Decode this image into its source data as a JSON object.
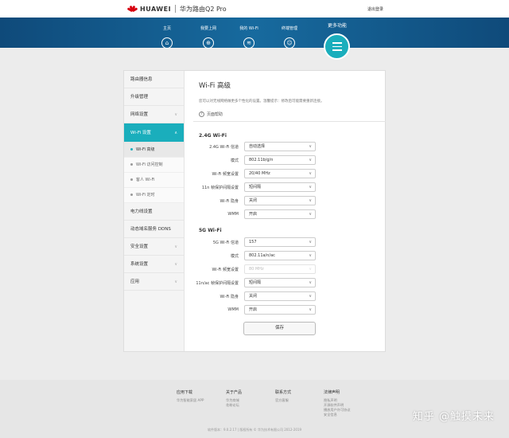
{
  "header": {
    "brand": "HUAWEI",
    "product": "华为路由Q2 Pro",
    "logout": "退出登录"
  },
  "nav": {
    "items": [
      {
        "label": "主页",
        "icon": "home-icon"
      },
      {
        "label": "我要上网",
        "icon": "globe-icon"
      },
      {
        "label": "我的 Wi-Fi",
        "icon": "wifi-icon"
      },
      {
        "label": "终端管理",
        "icon": "user-icon"
      }
    ],
    "more": "更多功能"
  },
  "sidebar": {
    "items": [
      {
        "label": "路由器信息"
      },
      {
        "label": "升级管理"
      },
      {
        "label": "网络设置"
      },
      {
        "label": "Wi-Fi 设置"
      },
      {
        "label": "电力线设置"
      },
      {
        "label": "动态域名服务 DDNS"
      },
      {
        "label": "安全设置"
      },
      {
        "label": "系统设置"
      },
      {
        "label": "应用"
      }
    ],
    "sub": [
      {
        "label": "Wi-Fi 高级"
      },
      {
        "label": "Wi-Fi 访问控制"
      },
      {
        "label": "客人 Wi-Fi"
      },
      {
        "label": "Wi-Fi 定时"
      }
    ]
  },
  "main": {
    "title": "Wi-Fi 高级",
    "description": "您可以对无线网络做更多个性化的设置。温馨提示：修改后可能需要重新连接。",
    "help": "页面帮助",
    "section24": {
      "title": "2.4G Wi-Fi",
      "rows": [
        {
          "label": "2.4G Wi-Fi 信道",
          "value": "自动选择"
        },
        {
          "label": "模式",
          "value": "802.11b/g/n"
        },
        {
          "label": "Wi-Fi 频宽设置",
          "value": "20/40 MHz"
        },
        {
          "label": "11n 帧保护间隔设置",
          "value": "短间隔"
        },
        {
          "label": "Wi-Fi 隐身",
          "value": "关闭"
        },
        {
          "label": "WMM",
          "value": "开启"
        }
      ]
    },
    "section5": {
      "title": "5G Wi-Fi",
      "rows": [
        {
          "label": "5G Wi-Fi 信道",
          "value": "157"
        },
        {
          "label": "模式",
          "value": "802.11a/n/ac"
        },
        {
          "label": "Wi-Fi 频宽设置",
          "value": "80 MHz"
        },
        {
          "label": "11n/ac 帧保护间隔设置",
          "value": "短间隔"
        },
        {
          "label": "Wi-Fi 隐身",
          "value": "关闭"
        },
        {
          "label": "WMM",
          "value": "开启"
        }
      ]
    },
    "save": "保存"
  },
  "footer": {
    "cols": [
      {
        "title": "应用下载",
        "links": [
          "华为智能家居 APP"
        ]
      },
      {
        "title": "关于产品",
        "links": [
          "华为商城",
          "花粉论坛"
        ]
      },
      {
        "title": "联系方式",
        "links": [
          "官方客服"
        ]
      },
      {
        "title": "法律声明",
        "links": [
          "隐私声明",
          "开源软件声明",
          "播放用户许可协议",
          "安全信息"
        ]
      }
    ],
    "copyright": "软件版本：9.0.2.17  |  版权所有 © 华为技术有限公司 2012-2019"
  },
  "watermark": "知乎 @触摸未来"
}
